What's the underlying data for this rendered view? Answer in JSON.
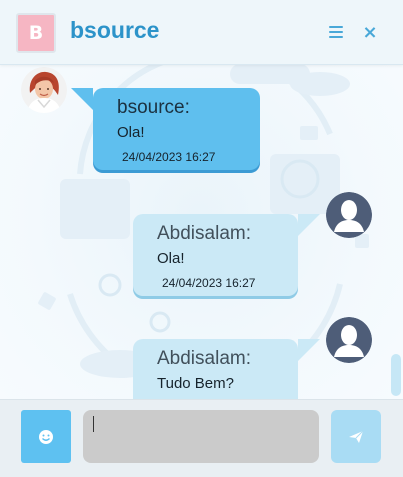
{
  "header": {
    "badge_letter": "B",
    "title": "bsource",
    "menu_icon": "hamburger-icon",
    "close_icon": "close-icon",
    "close_glyph": "×"
  },
  "messages": [
    {
      "direction": "in",
      "sender": "bsource",
      "sender_label": "bsource:",
      "text": "Ola!",
      "timestamp": "24/04/2023 16:27",
      "avatar": "agent-photo-avatar"
    },
    {
      "direction": "out",
      "sender": "Abdisalam",
      "sender_label": "Abdisalam:",
      "text": "Ola!",
      "timestamp": "24/04/2023 16:27",
      "avatar": "user-placeholder-avatar"
    },
    {
      "direction": "out",
      "sender": "Abdisalam",
      "sender_label": "Abdisalam:",
      "text": "Tudo Bem?",
      "timestamp": "",
      "avatar": "user-placeholder-avatar"
    }
  ],
  "composer": {
    "emoji_icon": "smiley-icon",
    "input_value": "",
    "send_icon": "paper-plane-icon"
  },
  "colors": {
    "brand": "#2c93c9",
    "badge": "#f6b6c3",
    "incoming_bubble": "#5fbfee",
    "outgoing_bubble": "#cbe9f6",
    "emoji_button": "#5ec1f1",
    "send_button": "#a9dcf4",
    "input_bg": "#cbcbcb"
  }
}
